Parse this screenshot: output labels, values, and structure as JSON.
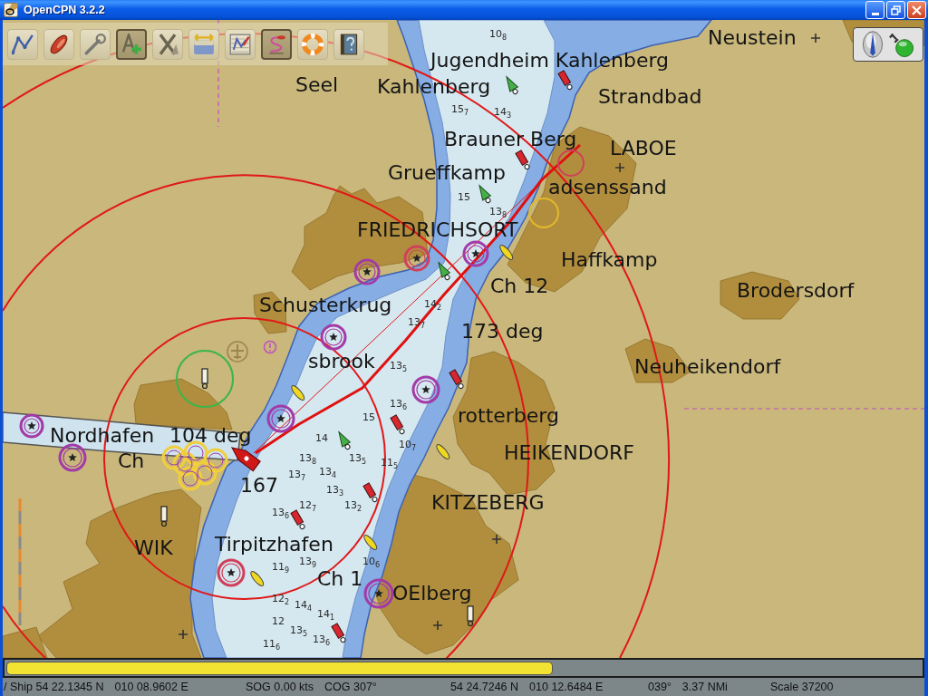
{
  "window": {
    "title": "OpenCPN 3.2.2"
  },
  "toolbar": {
    "tools": [
      {
        "kind": "route",
        "on": false
      },
      {
        "kind": "follow",
        "on": false
      },
      {
        "kind": "settings",
        "on": false
      },
      {
        "kind": "text",
        "on": true
      },
      {
        "kind": "marks",
        "on": false
      },
      {
        "kind": "tide",
        "on": false
      },
      {
        "kind": "route_manager",
        "on": false
      },
      {
        "kind": "track",
        "on": true
      },
      {
        "kind": "mob",
        "on": false
      },
      {
        "kind": "help",
        "on": false
      }
    ]
  },
  "status_panel": {
    "gps_fix": true
  },
  "chart": {
    "labels": [
      "Neustein",
      "Jugendheim Kahlenberg",
      "Seel",
      "Kahlenberg",
      "Strandbad",
      "Brauner Berg",
      "LABOE",
      "Grueffkamp",
      "adsenssand",
      "FRIEDRICHSORT",
      "Haffkamp",
      "Ch 12",
      "Brodersdorf",
      "Schusterkrug",
      "173 deg",
      "Neuheikendorf",
      "sbrook",
      "Nordhafen",
      "104 deg",
      "Ch",
      "rotterberg",
      "HEIKENDORF",
      "167",
      "KITZEBERG",
      "WIK",
      "Tirpitzhafen",
      "Ch 1",
      "OElberg"
    ],
    "soundings": [
      "10$_{8}$",
      "15$_{7}$",
      "14$_{3}$",
      "15",
      "13$_{8}$",
      "14$_{2}$",
      "13$_{7}$",
      "13$_{5}$",
      "13$_{6}$",
      "15",
      "10$_{7}$",
      "11$_{5}$",
      "14",
      "13$_{8}$",
      "13$_{7}$",
      "13$_{4}$",
      "13$_{5}$",
      "13$_{3}$",
      "13$_{2}$",
      "12$_{7}$",
      "13$_{6}$",
      "11$_{9}$",
      "13$_{9}$",
      "10$_{6}$",
      "12$_{2}$",
      "14$_{4}$",
      "14$_{1}$",
      "12",
      "13$_{5}$",
      "13$_{6}$",
      "11$_{6}$"
    ]
  },
  "chart_bar": {
    "keys": [
      {
        "kind": "vector"
      }
    ]
  },
  "status_bar": {
    "fields": [
      {
        "texts": [
          "/ Ship 54 22.1345 N",
          "010 08.9602 E"
        ]
      },
      {
        "texts": [
          "SOG 0.00 kts",
          "COG 307°"
        ]
      },
      {
        "texts": [
          "54 24.7246 N",
          "010 12.6484 E"
        ]
      },
      {
        "texts": [
          "039°",
          "3.37 NMi"
        ]
      },
      {
        "texts": [
          "Scale 37200"
        ]
      }
    ]
  }
}
